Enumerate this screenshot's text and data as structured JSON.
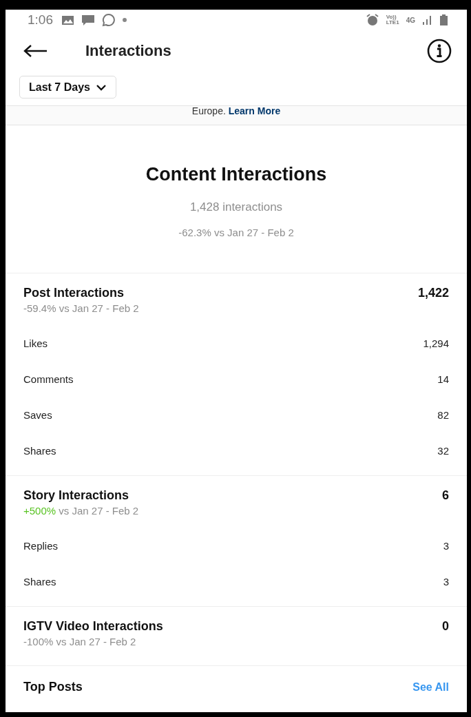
{
  "status_bar": {
    "time": "1:06",
    "volte": "Vo))",
    "lte": "LTE1",
    "network": "4G"
  },
  "header": {
    "title": "Interactions"
  },
  "filter": {
    "label": "Last 7 Days"
  },
  "notice": {
    "text": "Europe.",
    "link": "Learn More"
  },
  "summary": {
    "title": "Content Interactions",
    "total": "1,428 interactions",
    "delta": "-62.3% vs Jan 27 - Feb 2"
  },
  "sections": [
    {
      "title": "Post Interactions",
      "value": "1,422",
      "change": "-59.4%",
      "color": "#8e8e8e",
      "comparison": "vs Jan 27 - Feb 2",
      "rows": [
        {
          "label": "Likes",
          "value": "1,294"
        },
        {
          "label": "Comments",
          "value": "14"
        },
        {
          "label": "Saves",
          "value": "82"
        },
        {
          "label": "Shares",
          "value": "32"
        }
      ]
    },
    {
      "title": "Story Interactions",
      "value": "6",
      "change": "+500%",
      "color": "#58c322",
      "comparison": "vs Jan 27 - Feb 2",
      "rows": [
        {
          "label": "Replies",
          "value": "3"
        },
        {
          "label": "Shares",
          "value": "3"
        }
      ]
    },
    {
      "title": "IGTV Video Interactions",
      "value": "0",
      "change": "-100%",
      "color": "#8e8e8e",
      "comparison": "vs Jan 27 - Feb 2"
    }
  ],
  "top_posts": {
    "title": "Top Posts",
    "link": "See All"
  }
}
